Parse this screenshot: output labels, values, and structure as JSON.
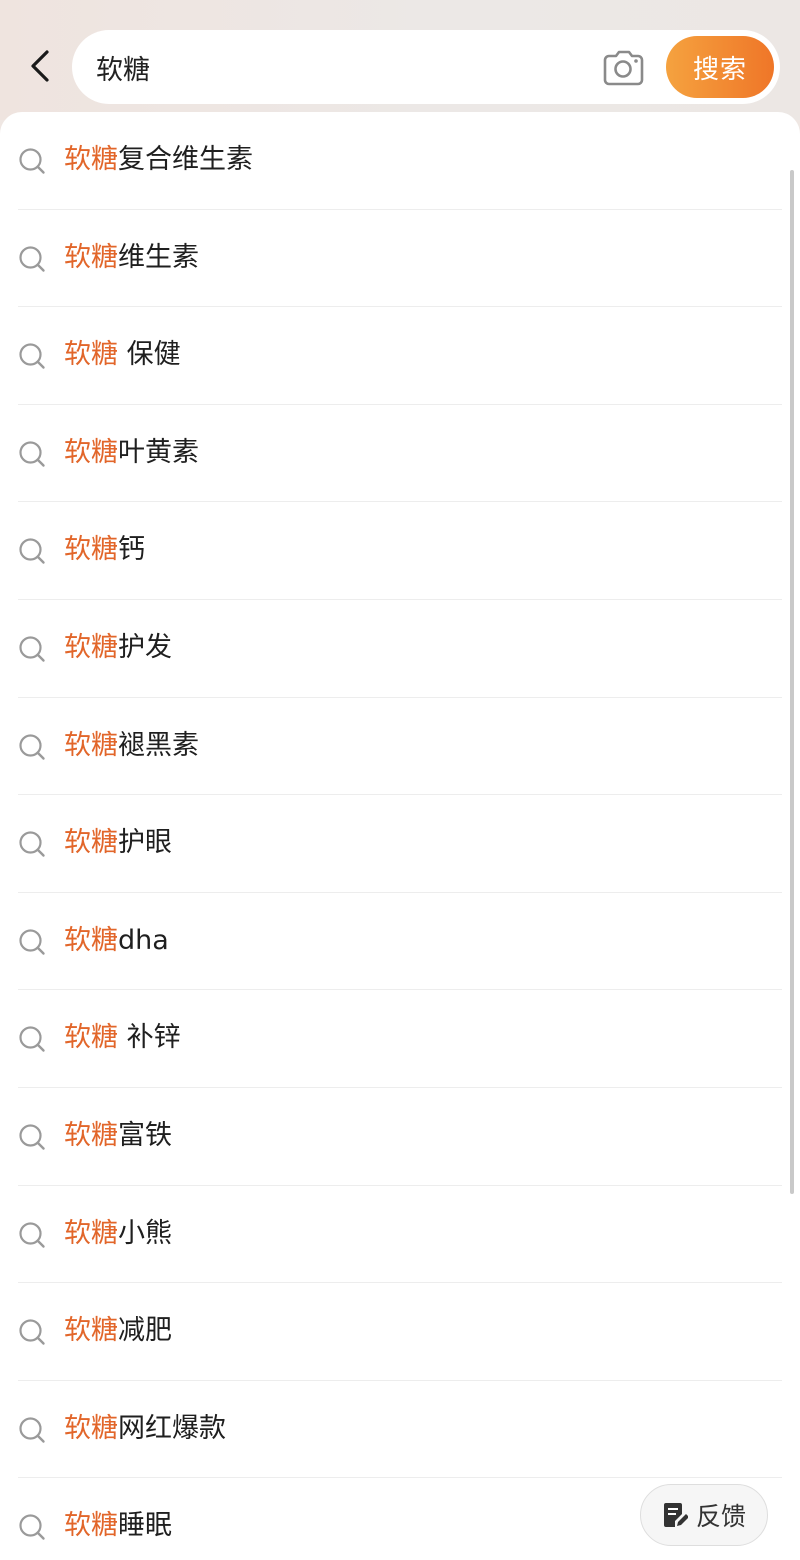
{
  "search": {
    "query": "软糖",
    "button_label": "搜索"
  },
  "suggestions": [
    {
      "highlight": "软糖",
      "rest": "复合维生素"
    },
    {
      "highlight": "软糖",
      "rest": "维生素"
    },
    {
      "highlight": "软糖",
      "rest": " 保健"
    },
    {
      "highlight": "软糖",
      "rest": "叶黄素"
    },
    {
      "highlight": "软糖",
      "rest": "钙"
    },
    {
      "highlight": "软糖",
      "rest": "护发"
    },
    {
      "highlight": "软糖",
      "rest": "褪黑素"
    },
    {
      "highlight": "软糖",
      "rest": "护眼"
    },
    {
      "highlight": "软糖",
      "rest": "dha"
    },
    {
      "highlight": "软糖",
      "rest": " 补锌"
    },
    {
      "highlight": "软糖",
      "rest": "富铁"
    },
    {
      "highlight": "软糖",
      "rest": "小熊"
    },
    {
      "highlight": "软糖",
      "rest": "减肥"
    },
    {
      "highlight": "软糖",
      "rest": "网红爆款"
    },
    {
      "highlight": "软糖",
      "rest": "睡眠"
    }
  ],
  "feedback": {
    "label": "反馈"
  },
  "icons": {
    "back": "chevron-left-icon",
    "camera": "camera-icon",
    "suggestion": "search-icon",
    "feedback": "edit-note-icon"
  },
  "colors": {
    "accent": "#e2662a",
    "button_start": "#f5a23f",
    "button_end": "#ef7628"
  }
}
